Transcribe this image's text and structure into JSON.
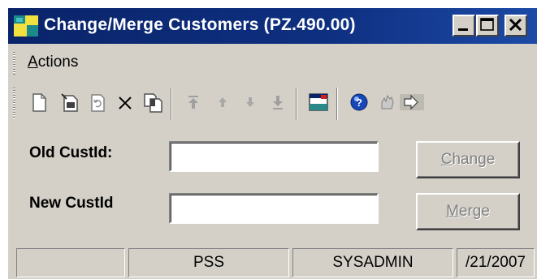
{
  "window": {
    "title": "Change/Merge Customers (PZ.490.00)",
    "controls": [
      "minimize",
      "maximize",
      "close"
    ]
  },
  "menu": {
    "actions_prefix": "",
    "actions_accel": "A",
    "actions_rest": "ctions"
  },
  "toolbar": {
    "buttons": [
      "new-icon",
      "save-icon",
      "refresh-icon",
      "delete-icon",
      "copy-icon",
      "first-icon",
      "previous-icon",
      "next-icon",
      "last-icon",
      "close-screen-icon",
      "help-icon",
      "customize-icon",
      "navigate-icon"
    ]
  },
  "form": {
    "old_label": "Old CustId:",
    "old_value": "",
    "new_label": "New CustId",
    "new_value": ""
  },
  "buttons": {
    "change_accel": "C",
    "change_rest": "hange",
    "merge_accel": "M",
    "merge_rest": "erge"
  },
  "status": {
    "panel1": "",
    "panel2": "PSS",
    "panel3": "SYSADMIN",
    "panel4": "/21/2007"
  }
}
